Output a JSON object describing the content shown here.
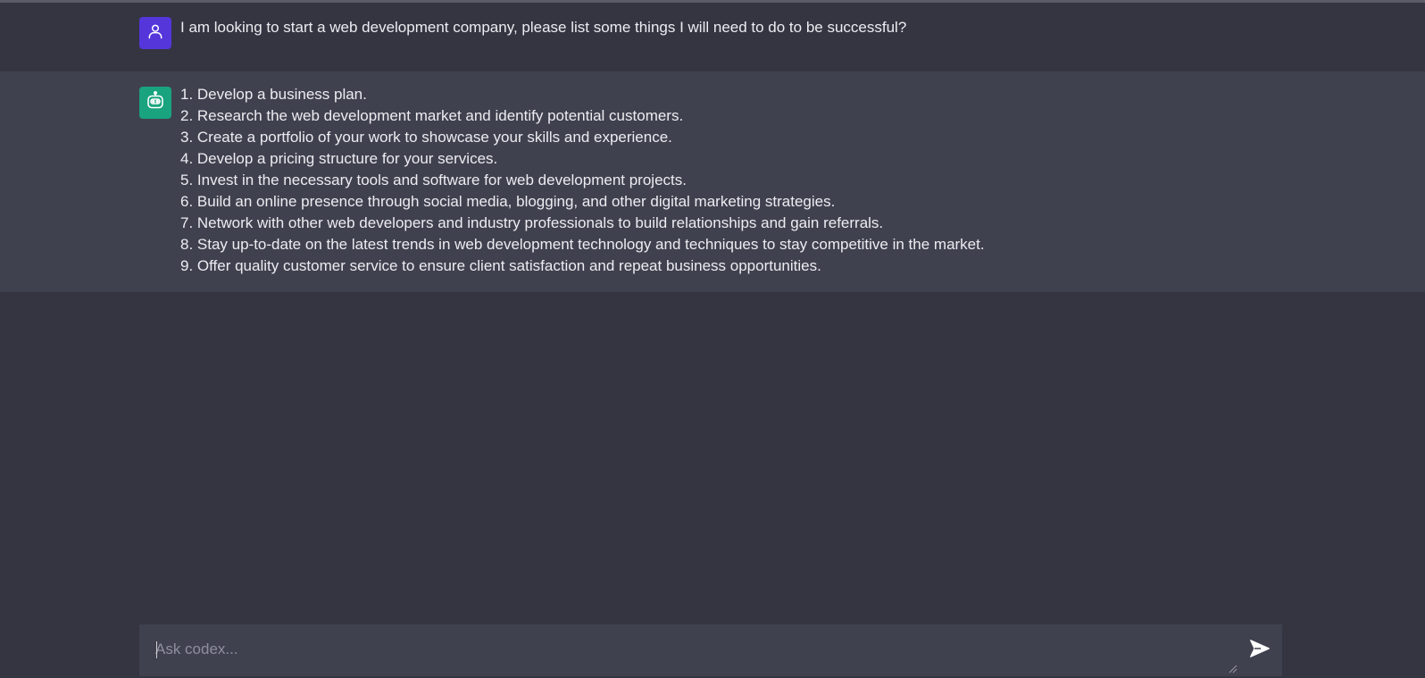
{
  "conversation": {
    "user_message": {
      "avatar_icon": "user-icon",
      "text": "I am looking to start a web development company, please list some things I will need to do to be successful?"
    },
    "bot_message": {
      "avatar_icon": "robot-icon",
      "lines": [
        "1. Develop a business plan.",
        "2. Research the web development market and identify potential customers.",
        "3. Create a portfolio of your work to showcase your skills and experience.",
        "4. Develop a pricing structure for your services.",
        "5. Invest in the necessary tools and software for web development projects.",
        "6. Build an online presence through social media, blogging, and other digital marketing strategies.",
        "7. Network with other web developers and industry professionals to build relationships and gain referrals.",
        "8. Stay up-to-date on the latest trends in web development technology and techniques to stay competitive in the market.",
        "9. Offer quality customer service to ensure client satisfaction and repeat business opportunities."
      ]
    }
  },
  "composer": {
    "placeholder": "Ask codex...",
    "value": "",
    "send_icon": "send-icon"
  },
  "colors": {
    "background": "#343541",
    "bot_row": "#40414f",
    "user_avatar": "#5436da",
    "bot_avatar": "#19a37f",
    "text": "#ececf1",
    "placeholder": "#8e8ea0"
  }
}
